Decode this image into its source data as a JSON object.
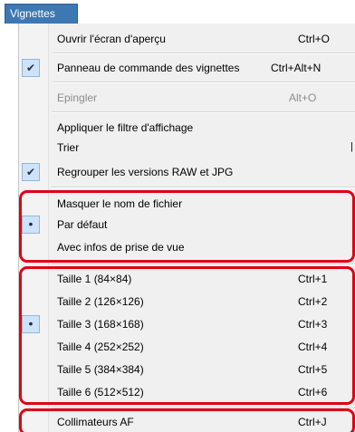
{
  "menu": {
    "title": "Vignettes"
  },
  "items": [
    {
      "label": "Ouvrir l'écran d'aperçu",
      "shortcut": "Ctrl+O",
      "mark": ""
    },
    {
      "label": "Panneau de commande des vignettes",
      "shortcut": "Ctrl+Alt+N",
      "mark": "✔"
    },
    {
      "label": "Epingler",
      "shortcut": "Alt+O",
      "mark": ""
    },
    {
      "label": "Appliquer le filtre d'affichage",
      "shortcut": "",
      "mark": ""
    },
    {
      "label": "Trier",
      "shortcut": "",
      "mark": ""
    },
    {
      "label": "Regrouper les versions RAW et JPG",
      "shortcut": "",
      "mark": "✔"
    },
    {
      "label": "Masquer le nom de fichier",
      "shortcut": "",
      "mark": ""
    },
    {
      "label": "Par défaut",
      "shortcut": "",
      "mark": "•"
    },
    {
      "label": "Avec infos de prise de vue",
      "shortcut": "",
      "mark": ""
    },
    {
      "label": "Taille 1 (84×84)",
      "shortcut": "Ctrl+1",
      "mark": ""
    },
    {
      "label": "Taille 2 (126×126)",
      "shortcut": "Ctrl+2",
      "mark": ""
    },
    {
      "label": "Taille 3 (168×168)",
      "shortcut": "Ctrl+3",
      "mark": "•"
    },
    {
      "label": "Taille 4 (252×252)",
      "shortcut": "Ctrl+4",
      "mark": ""
    },
    {
      "label": "Taille 5 (384×384)",
      "shortcut": "Ctrl+5",
      "mark": ""
    },
    {
      "label": "Taille 6 (512×512)",
      "shortcut": "Ctrl+6",
      "mark": ""
    },
    {
      "label": "Collimateurs AF",
      "shortcut": "Ctrl+J",
      "mark": ""
    }
  ],
  "states": {
    "disabled_item": "Epingler"
  },
  "colors": {
    "highlight": "#e00012",
    "menu_title_bg": "#3e78b2",
    "check_bg": "#cde3f7"
  }
}
